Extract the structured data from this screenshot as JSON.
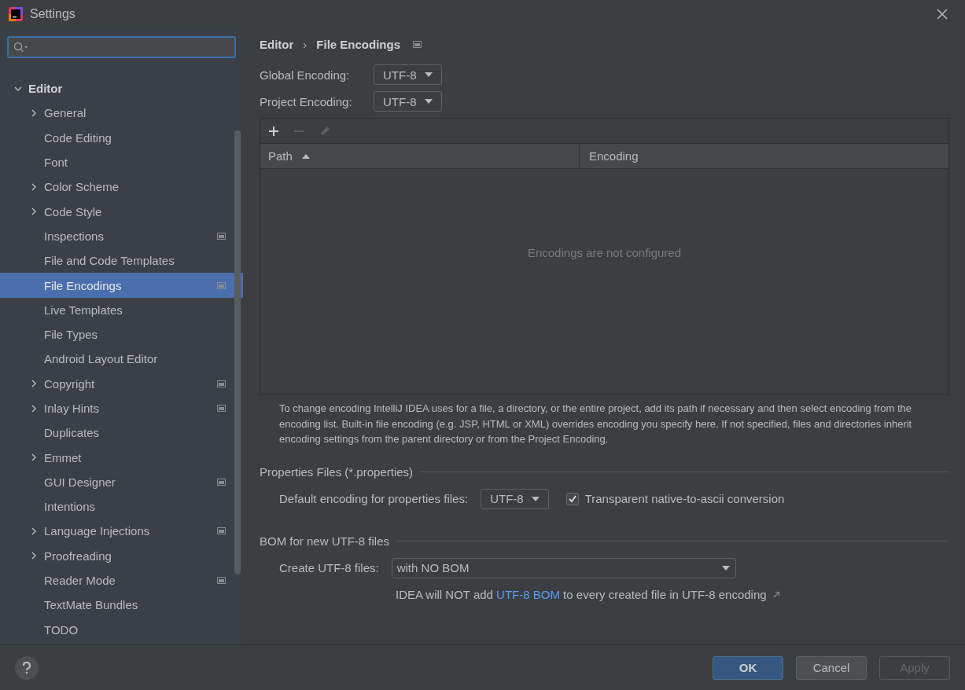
{
  "window": {
    "title": "Settings"
  },
  "sidebar": {
    "items": [
      {
        "label": "Editor",
        "expanded": true,
        "children": [
          {
            "label": "General",
            "kind": "group",
            "expanded": false,
            "selected": false,
            "project_icon": false
          },
          {
            "label": "Code Editing",
            "kind": "leaf",
            "selected": false,
            "project_icon": false
          },
          {
            "label": "Font",
            "kind": "leaf",
            "selected": false,
            "project_icon": false
          },
          {
            "label": "Color Scheme",
            "kind": "group",
            "expanded": false,
            "selected": false,
            "project_icon": false
          },
          {
            "label": "Code Style",
            "kind": "group",
            "expanded": false,
            "selected": false,
            "project_icon": false
          },
          {
            "label": "Inspections",
            "kind": "leaf",
            "selected": false,
            "project_icon": true
          },
          {
            "label": "File and Code Templates",
            "kind": "leaf",
            "selected": false,
            "project_icon": false
          },
          {
            "label": "File Encodings",
            "kind": "leaf",
            "selected": true,
            "project_icon": true
          },
          {
            "label": "Live Templates",
            "kind": "leaf",
            "selected": false,
            "project_icon": false
          },
          {
            "label": "File Types",
            "kind": "leaf",
            "selected": false,
            "project_icon": false
          },
          {
            "label": "Android Layout Editor",
            "kind": "leaf",
            "selected": false,
            "project_icon": false
          },
          {
            "label": "Copyright",
            "kind": "group",
            "expanded": false,
            "selected": false,
            "project_icon": true
          },
          {
            "label": "Inlay Hints",
            "kind": "group",
            "expanded": false,
            "selected": false,
            "project_icon": true
          },
          {
            "label": "Duplicates",
            "kind": "leaf",
            "selected": false,
            "project_icon": false
          },
          {
            "label": "Emmet",
            "kind": "group",
            "expanded": false,
            "selected": false,
            "project_icon": false
          },
          {
            "label": "GUI Designer",
            "kind": "leaf",
            "selected": false,
            "project_icon": true
          },
          {
            "label": "Intentions",
            "kind": "leaf",
            "selected": false,
            "project_icon": false
          },
          {
            "label": "Language Injections",
            "kind": "group",
            "expanded": false,
            "selected": false,
            "project_icon": true
          },
          {
            "label": "Proofreading",
            "kind": "group",
            "expanded": false,
            "selected": false,
            "project_icon": false
          },
          {
            "label": "Reader Mode",
            "kind": "leaf",
            "selected": false,
            "project_icon": true
          },
          {
            "label": "TextMate Bundles",
            "kind": "leaf",
            "selected": false,
            "project_icon": false
          },
          {
            "label": "TODO",
            "kind": "leaf",
            "selected": false,
            "project_icon": false
          }
        ]
      }
    ]
  },
  "breadcrumb": {
    "parent": "Editor",
    "separator": "›",
    "current": "File Encodings",
    "project_icon": true
  },
  "encodings": [
    {
      "label": "Global Encoding:",
      "value": "UTF-8"
    },
    {
      "label": "Project Encoding:",
      "value": "UTF-8"
    }
  ],
  "table": {
    "toolbar": [
      {
        "kind": "add",
        "disabled": false
      },
      {
        "kind": "remove",
        "disabled": true
      },
      {
        "kind": "edit",
        "disabled": true
      }
    ],
    "columns": [
      {
        "label": "Path",
        "sorted": true
      },
      {
        "label": "Encoding",
        "sorted": false
      }
    ],
    "empty_text": "Encodings are not configured"
  },
  "description": "To change encoding IntelliJ IDEA uses for a file, a directory, or the entire project, add its path if necessary and then select encoding from the encoding list. Built-in file encoding (e.g. JSP, HTML or XML) overrides encoding you specify here. If not specified, files and directories inherit encoding settings from the parent directory or from the Project Encoding.",
  "properties_section": {
    "title": "Properties Files (*.properties)",
    "label": "Default encoding for properties files:",
    "value": "UTF-8",
    "checkbox": {
      "label": "Transparent native-to-ascii conversion",
      "checked": true
    }
  },
  "bom_section": {
    "title": "BOM for new UTF-8 files",
    "label": "Create UTF-8 files:",
    "value": "with NO BOM",
    "note_before": "IDEA will NOT add ",
    "note_link": "UTF-8 BOM",
    "note_after": " to every created file in UTF-8 encoding"
  },
  "buttons": [
    {
      "label": "OK",
      "kind": "primary",
      "disabled": false
    },
    {
      "label": "Cancel",
      "kind": "normal",
      "disabled": false
    },
    {
      "label": "Apply",
      "kind": "normal",
      "disabled": true
    }
  ]
}
